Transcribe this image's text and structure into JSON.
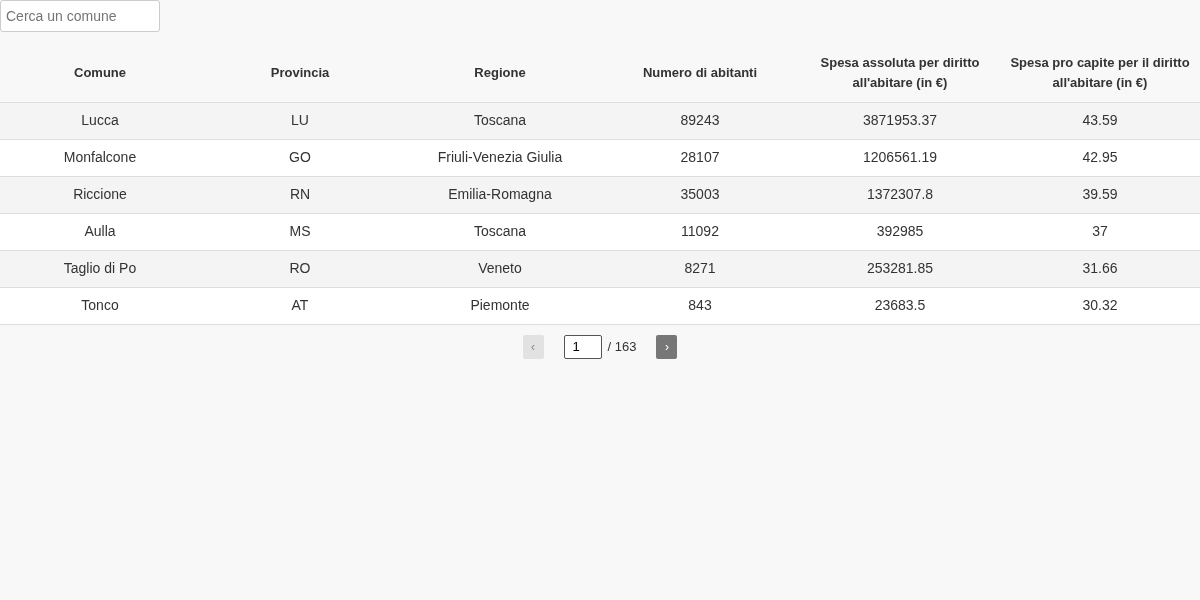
{
  "search": {
    "placeholder": "Cerca un comune"
  },
  "table": {
    "columns": [
      "Comune",
      "Provincia",
      "Regione",
      "Numero di abitanti",
      "Spesa assoluta per diritto all'abitare (in €)",
      "Spesa pro capite per il diritto all'abitare (in €)"
    ],
    "rows": [
      [
        "Lucca",
        "LU",
        "Toscana",
        "89243",
        "3871953.37",
        "43.59"
      ],
      [
        "Monfalcone",
        "GO",
        "Friuli-Venezia Giulia",
        "28107",
        "1206561.19",
        "42.95"
      ],
      [
        "Riccione",
        "RN",
        "Emilia-Romagna",
        "35003",
        "1372307.8",
        "39.59"
      ],
      [
        "Aulla",
        "MS",
        "Toscana",
        "11092",
        "392985",
        "37"
      ],
      [
        "Taglio di Po",
        "RO",
        "Veneto",
        "8271",
        "253281.85",
        "31.66"
      ],
      [
        "Tonco",
        "AT",
        "Piemonte",
        "843",
        "23683.5",
        "30.32"
      ]
    ]
  },
  "pagination": {
    "prev": {
      "label": "‹",
      "disabled": true
    },
    "page": "1",
    "total": "/ 163",
    "next": {
      "label": "›",
      "disabled": false
    }
  }
}
